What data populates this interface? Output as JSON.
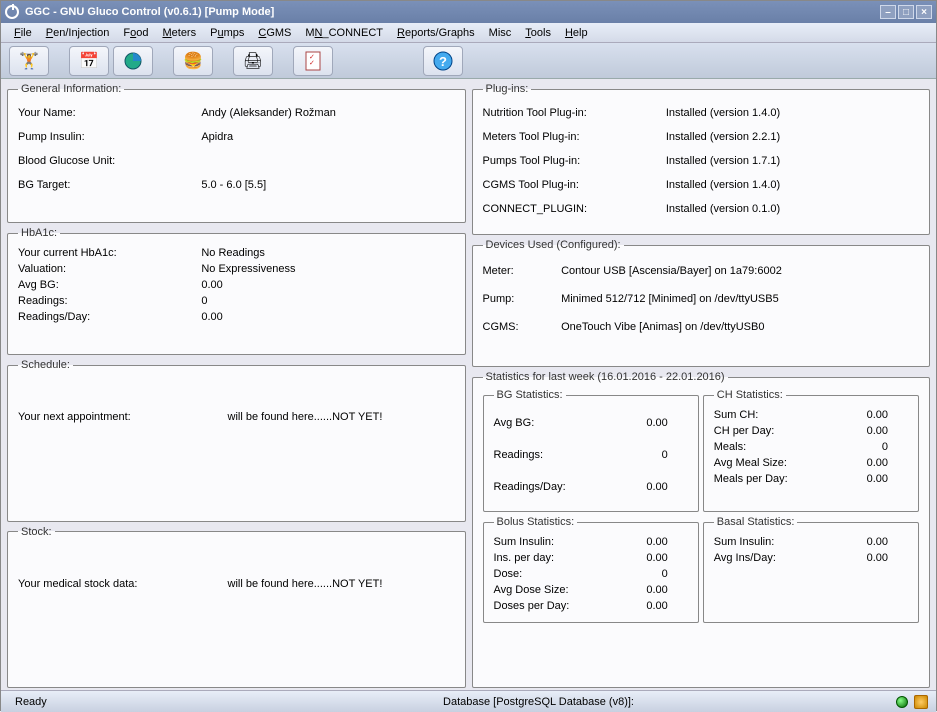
{
  "window": {
    "title": "GGC - GNU Gluco Control (v0.6.1) [Pump Mode]"
  },
  "menu": [
    "File",
    "Pen/Injection",
    "Food",
    "Meters",
    "Pumps",
    "CGMS",
    "MN_CONNECT",
    "Reports/Graphs",
    "Misc",
    "Tools",
    "Help"
  ],
  "general": {
    "legend": "General Information:",
    "name_label": "Your Name:",
    "name_value": "Andy (Aleksander) Rožman",
    "insulin_label": "Pump Insulin:",
    "insulin_value": "Apidra",
    "bgu_label": "Blood Glucose Unit:",
    "bgu_value": "",
    "target_label": "BG Target:",
    "target_value": "5.0 - 6.0 [5.5]"
  },
  "hba1c": {
    "legend": "HbA1c:",
    "current_label": "Your current HbA1c:",
    "current_value": "No Readings",
    "valuation_label": "Valuation:",
    "valuation_value": "No Expressiveness",
    "avgbg_label": "Avg BG:",
    "avgbg_value": "0.00",
    "readings_label": "Readings:",
    "readings_value": "0",
    "rpd_label": "Readings/Day:",
    "rpd_value": "0.00"
  },
  "schedule": {
    "legend": "Schedule:",
    "label": "Your next appointment:",
    "value": "will be found here......NOT YET!"
  },
  "stock": {
    "legend": "Stock:",
    "label": "Your medical stock data:",
    "value": "will be found here......NOT YET!"
  },
  "plugins": {
    "legend": "Plug-ins:",
    "items": [
      {
        "label": "Nutrition Tool Plug-in:",
        "value": "Installed (version 1.4.0)"
      },
      {
        "label": "Meters Tool Plug-in:",
        "value": "Installed (version 2.2.1)"
      },
      {
        "label": "Pumps Tool Plug-in:",
        "value": "Installed (version 1.7.1)"
      },
      {
        "label": "CGMS Tool Plug-in:",
        "value": "Installed (version 1.4.0)"
      },
      {
        "label": "CONNECT_PLUGIN:",
        "value": "Installed (version 0.1.0)"
      }
    ]
  },
  "devices": {
    "legend": "Devices Used (Configured):",
    "items": [
      {
        "label": "Meter:",
        "value": "Contour USB [Ascensia/Bayer] on 1a79:6002"
      },
      {
        "label": "Pump:",
        "value": "Minimed 512/712 [Minimed] on /dev/ttyUSB5"
      },
      {
        "label": "CGMS:",
        "value": "OneTouch Vibe [Animas] on /dev/ttyUSB0"
      }
    ]
  },
  "stats": {
    "legend": "Statistics for last week (16.01.2016 - 22.01.2016)",
    "bg": {
      "legend": "BG Statistics:",
      "rows": [
        {
          "label": "Avg BG:",
          "value": "0.00"
        },
        {
          "label": "Readings:",
          "value": "0"
        },
        {
          "label": "Readings/Day:",
          "value": "0.00"
        }
      ]
    },
    "ch": {
      "legend": "CH Statistics:",
      "rows": [
        {
          "label": "Sum CH:",
          "value": "0.00"
        },
        {
          "label": "CH per Day:",
          "value": "0.00"
        },
        {
          "label": "Meals:",
          "value": "0"
        },
        {
          "label": "Avg Meal Size:",
          "value": "0.00"
        },
        {
          "label": "Meals per Day:",
          "value": "0.00"
        }
      ]
    },
    "bolus": {
      "legend": "Bolus Statistics:",
      "rows": [
        {
          "label": "Sum Insulin:",
          "value": "0.00"
        },
        {
          "label": "Ins. per day:",
          "value": "0.00"
        },
        {
          "label": "Dose:",
          "value": "0"
        },
        {
          "label": "Avg Dose Size:",
          "value": "0.00"
        },
        {
          "label": "Doses per Day:",
          "value": "0.00"
        }
      ]
    },
    "basal": {
      "legend": "Basal Statistics:",
      "rows": [
        {
          "label": "Sum Insulin:",
          "value": "0.00"
        },
        {
          "label": "Avg Ins/Day:",
          "value": "0.00"
        }
      ]
    }
  },
  "status": {
    "left": "Ready",
    "db": "Database [PostgreSQL Database (v8)]:"
  }
}
